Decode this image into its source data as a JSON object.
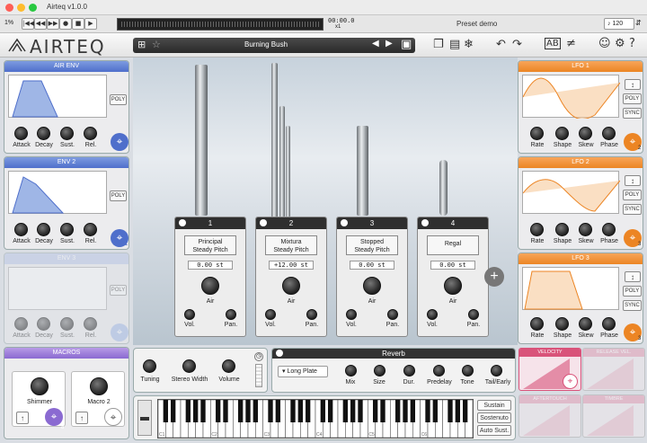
{
  "window": {
    "title": "Airteq v1.0.0"
  },
  "transport": {
    "percent": "1%",
    "time": "00:00.0",
    "speed": "x1",
    "preset_label": "Preset demo",
    "tempo_prefix": "♪",
    "tempo": "120",
    "tempo_icon": "⇵"
  },
  "header": {
    "logo": "AIRTEQ",
    "preset_name": "Burning Bush"
  },
  "env_panels": [
    {
      "title": "AIR ENV",
      "poly": "POLY",
      "knobs": [
        "Attack",
        "Decay",
        "Sust.",
        "Rel."
      ],
      "mod_index": ""
    },
    {
      "title": "ENV 2",
      "poly": "POLY",
      "knobs": [
        "Attack",
        "Decay",
        "Sust.",
        "Rel."
      ],
      "mod_index": "1"
    },
    {
      "title": "ENV 3",
      "poly": "POLY",
      "knobs": [
        "Attack",
        "Decay",
        "Sust.",
        "Rel."
      ],
      "mod_index": ""
    }
  ],
  "macros": {
    "title": "MACROS",
    "items": [
      {
        "label": "Shimmer",
        "mod_index": "8"
      },
      {
        "label": "Macro 2",
        "mod_index": ""
      }
    ]
  },
  "layers": [
    {
      "num": "1",
      "name1": "Principal",
      "name2": "Steady Pitch",
      "pitch": "0.00 st",
      "air": "Air",
      "vol": "Vol.",
      "pan": "Pan."
    },
    {
      "num": "2",
      "name1": "Mixtura",
      "name2": "Steady Pitch",
      "pitch": "+12.00 st",
      "air": "Air",
      "vol": "Vol.",
      "pan": "Pan."
    },
    {
      "num": "3",
      "name1": "Stopped",
      "name2": "Steady Pitch",
      "pitch": "0.00 st",
      "air": "Air",
      "vol": "Vol.",
      "pan": "Pan."
    },
    {
      "num": "4",
      "name1": "Regal",
      "name2": "",
      "pitch": "0.00 st",
      "air": "Air",
      "vol": "Vol.",
      "pan": "Pan."
    }
  ],
  "add_layer": "+",
  "lfos": [
    {
      "title": "LFO 1",
      "buttons": [
        "↕",
        "POLY",
        "SYNC"
      ],
      "knobs": [
        "Rate",
        "Shape",
        "Skew",
        "Phase"
      ],
      "mod_index": "2"
    },
    {
      "title": "LFO 2",
      "buttons": [
        "↕",
        "POLY",
        "SYNC"
      ],
      "knobs": [
        "Rate",
        "Shape",
        "Skew",
        "Phase"
      ],
      "mod_index": "3"
    },
    {
      "title": "LFO 3",
      "buttons": [
        "↕",
        "POLY",
        "SYNC"
      ],
      "knobs": [
        "Rate",
        "Shape",
        "Skew",
        "Phase"
      ],
      "mod_index": "3"
    }
  ],
  "global": {
    "tuning": "Tuning",
    "width": "Stereo Width",
    "volume": "Volume"
  },
  "reverb": {
    "title": "Reverb",
    "type": "Long Plate",
    "knobs": [
      "Mix",
      "Size",
      "Dur.",
      "Predelay",
      "Tone",
      "Tail/Early"
    ]
  },
  "keyboard": {
    "buttons": [
      "Sustain",
      "Sostenuto",
      "Auto Sust."
    ],
    "octave_labels": [
      "C1",
      "C2",
      "C3",
      "C4",
      "C5",
      "C6"
    ]
  },
  "velocity_panels": [
    "VELOCITY",
    "RELEASE VEL.",
    "AFTERTOUCH",
    "TIMBRE"
  ],
  "colors": {
    "blue": "#4f6fcb",
    "orange": "#ec8524",
    "purple": "#8a6ad1",
    "pink": "#d9537a"
  }
}
